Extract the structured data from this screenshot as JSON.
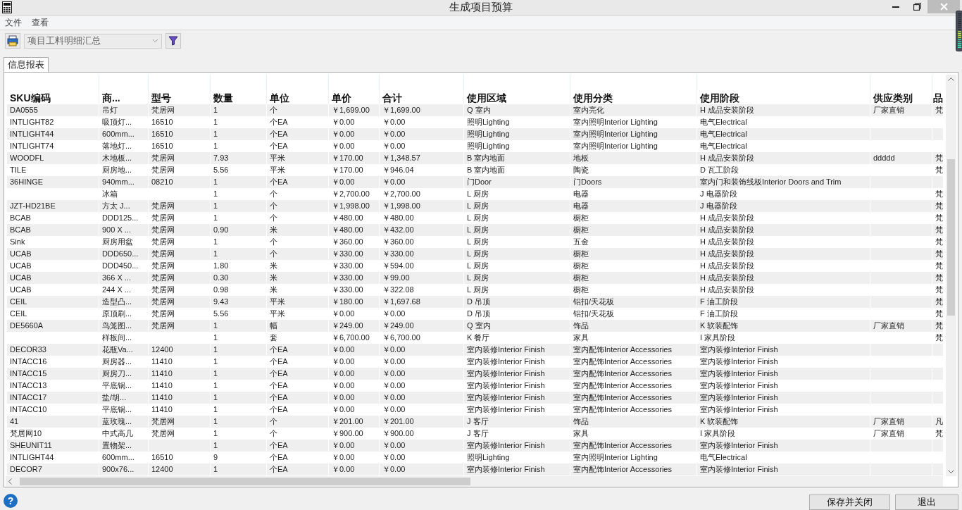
{
  "window": {
    "title": "生成项目预算"
  },
  "menu": [
    "文件",
    "查看"
  ],
  "toolbar": {
    "report_select": {
      "value": "项目工料明细汇总"
    }
  },
  "tabs": [
    {
      "label": "信息报表",
      "selected": true
    }
  ],
  "table": {
    "columns": [
      "SKU编码",
      "商...",
      "型号",
      "数量",
      "单位",
      "单价",
      "合计",
      "使用区域",
      "使用分类",
      "使用阶段",
      "供应类别",
      "品"
    ],
    "rows": [
      [
        "DA0555",
        "吊灯",
        "梵居网",
        "1",
        "个",
        "￥1,699.00",
        "￥1,699.00",
        "Q  室内",
        "室内亮化",
        "H  成品安装阶段",
        "厂家直销",
        "梵"
      ],
      [
        "INTLIGHT82",
        "吸顶灯...",
        "16510",
        "1",
        "个EA",
        "￥0.00",
        "￥0.00",
        "照明Lighting",
        "室内照明Interior Lighting",
        "电气Electrical",
        "",
        ""
      ],
      [
        "INTLIGHT44",
        "600mm...",
        "16510",
        "1",
        "个EA",
        "￥0.00",
        "￥0.00",
        "照明Lighting",
        "室内照明Interior Lighting",
        "电气Electrical",
        "",
        ""
      ],
      [
        "INTLIGHT74",
        "落地灯...",
        "16510",
        "1",
        "个EA",
        "￥0.00",
        "￥0.00",
        "照明Lighting",
        "室内照明Interior Lighting",
        "电气Electrical",
        "",
        ""
      ],
      [
        "WOODFL",
        "木地板...",
        "梵居网",
        "7.93",
        "平米",
        "￥170.00",
        "￥1,348.57",
        "B  室内地面",
        "地板",
        "H  成品安装阶段",
        "ddddd",
        "梵"
      ],
      [
        "TILE",
        "厨房地...",
        "梵居网",
        "5.56",
        "平米",
        "￥170.00",
        "￥946.04",
        "B  室内地面",
        "陶瓷",
        "D  瓦工阶段",
        "",
        "梵"
      ],
      [
        "36HINGE",
        "940mm...",
        "08210",
        "1",
        "个EA",
        "￥0.00",
        "￥0.00",
        "门Door",
        "门Doors",
        "室内门和装饰线板Interior Doors and Trim",
        "",
        ""
      ],
      [
        "",
        "冰箱",
        "",
        "1",
        "个",
        "￥2,700.00",
        "￥2,700.00",
        "L  厨房",
        "电器",
        "J  电器阶段",
        "",
        "梵"
      ],
      [
        "JZT-HD21BE",
        "方太 J...",
        "梵居网",
        "1",
        "个",
        "￥1,998.00",
        "￥1,998.00",
        "L  厨房",
        "电器",
        "J  电器阶段",
        "",
        "梵"
      ],
      [
        "BCAB",
        "DDD125...",
        "梵居网",
        "1",
        "个",
        "￥480.00",
        "￥480.00",
        "L  厨房",
        "橱柜",
        "H  成品安装阶段",
        "",
        "梵"
      ],
      [
        "BCAB",
        "900 X ...",
        "梵居网",
        "0.90",
        "米",
        "￥480.00",
        "￥432.00",
        "L  厨房",
        "橱柜",
        "H  成品安装阶段",
        "",
        "梵"
      ],
      [
        "Sink",
        "厨房用盆",
        "梵居网",
        "1",
        "个",
        "￥360.00",
        "￥360.00",
        "L  厨房",
        "五金",
        "H  成品安装阶段",
        "",
        "梵"
      ],
      [
        "UCAB",
        "DDD650...",
        "梵居网",
        "1",
        "个",
        "￥330.00",
        "￥330.00",
        "L  厨房",
        "橱柜",
        "H  成品安装阶段",
        "",
        "梵"
      ],
      [
        "UCAB",
        "DDD450...",
        "梵居网",
        "1.80",
        "米",
        "￥330.00",
        "￥594.00",
        "L  厨房",
        "橱柜",
        "H  成品安装阶段",
        "",
        "梵"
      ],
      [
        "UCAB",
        "366 X ...",
        "梵居网",
        "0.30",
        "米",
        "￥330.00",
        "￥99.00",
        "L  厨房",
        "橱柜",
        "H  成品安装阶段",
        "",
        "梵"
      ],
      [
        "UCAB",
        "244 X ...",
        "梵居网",
        "0.98",
        "米",
        "￥330.00",
        "￥322.08",
        "L  厨房",
        "橱柜",
        "H  成品安装阶段",
        "",
        "梵"
      ],
      [
        "CEIL",
        "造型凸...",
        "梵居网",
        "9.43",
        "平米",
        "￥180.00",
        "￥1,697.68",
        "D  吊顶",
        "铝扣/天花板",
        "F  油工阶段",
        "",
        "梵"
      ],
      [
        "CEIL",
        "原顶刷...",
        "梵居网",
        "5.56",
        "平米",
        "￥0.00",
        "￥0.00",
        "D  吊顶",
        "铝扣/天花板",
        "F  油工阶段",
        "",
        "梵"
      ],
      [
        "DE5660A",
        "鸟笼图...",
        "梵居网",
        "1",
        "幅",
        "￥249.00",
        "￥249.00",
        "Q  室内",
        "饰品",
        "K  软装配饰",
        "厂家直销",
        "梵"
      ],
      [
        "",
        "样板间...",
        "",
        "1",
        "套",
        "￥6,700.00",
        "￥6,700.00",
        "K  餐厅",
        "家具",
        "I  家具阶段",
        "",
        "梵"
      ],
      [
        "DECOR33",
        "花瓶Va...",
        "12400",
        "1",
        "个EA",
        "￥0.00",
        "￥0.00",
        "室内装修Interior Finish",
        "室内配饰Interior Accessories",
        "室内装修Interior Finish",
        "",
        ""
      ],
      [
        "INTACC16",
        "厨房器...",
        "11410",
        "1",
        "个EA",
        "￥0.00",
        "￥0.00",
        "室内装修Interior Finish",
        "室内配饰Interior Accessories",
        "室内装修Interior Finish",
        "",
        ""
      ],
      [
        "INTACC15",
        "厨房刀...",
        "11410",
        "1",
        "个EA",
        "￥0.00",
        "￥0.00",
        "室内装修Interior Finish",
        "室内配饰Interior Accessories",
        "室内装修Interior Finish",
        "",
        ""
      ],
      [
        "INTACC13",
        "平底锅...",
        "11410",
        "1",
        "个EA",
        "￥0.00",
        "￥0.00",
        "室内装修Interior Finish",
        "室内配饰Interior Accessories",
        "室内装修Interior Finish",
        "",
        ""
      ],
      [
        "INTACC17",
        "盐/胡...",
        "11410",
        "1",
        "个EA",
        "￥0.00",
        "￥0.00",
        "室内装修Interior Finish",
        "室内配饰Interior Accessories",
        "室内装修Interior Finish",
        "",
        ""
      ],
      [
        "INTACC10",
        "平底锅...",
        "11410",
        "1",
        "个EA",
        "￥0.00",
        "￥0.00",
        "室内装修Interior Finish",
        "室内配饰Interior Accessories",
        "室内装修Interior Finish",
        "",
        ""
      ],
      [
        "41",
        "蓝玫瑰...",
        "梵居网",
        "1",
        "个",
        "￥201.00",
        "￥201.00",
        "J  客厅",
        "饰品",
        "K  软装配饰",
        "厂家直销",
        "凡"
      ],
      [
        "梵居网10",
        "中式高几",
        "梵居网",
        "1",
        "个",
        "￥900.00",
        "￥900.00",
        "J  客厅",
        "家具",
        "I  家具阶段",
        "厂家直销",
        "梵"
      ],
      [
        "SHEUNIT11",
        "置物架...",
        "",
        "1",
        "个EA",
        "￥0.00",
        "￥0.00",
        "室内装修Interior Finish",
        "室内配饰Interior Accessories",
        "室内装修Interior Finish",
        "",
        ""
      ],
      [
        "INTLIGHT44",
        "600mm...",
        "16510",
        "9",
        "个EA",
        "￥0.00",
        "￥0.00",
        "照明Lighting",
        "室内照明Interior Lighting",
        "电气Electrical",
        "",
        ""
      ],
      [
        "DECOR7",
        "900x76...",
        "12400",
        "1",
        "个EA",
        "￥0.00",
        "￥0.00",
        "室内装修Interior Finish",
        "室内配饰Interior Accessories",
        "室内装修Interior Finish",
        "",
        ""
      ]
    ]
  },
  "help_button": {
    "label": "?"
  },
  "buttons": [
    "保存并关闭",
    "退出"
  ]
}
